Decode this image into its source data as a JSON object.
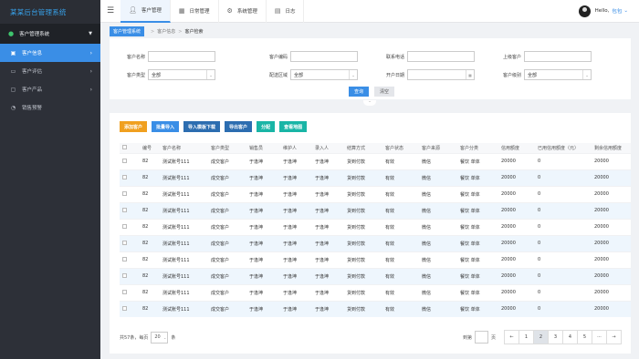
{
  "app": {
    "title": "某某后台管理系统"
  },
  "sidebar": {
    "system_label": "客户管理系统",
    "items": [
      {
        "label": "客户信息",
        "icon": "user-icon"
      },
      {
        "label": "客户评估",
        "icon": "folder-icon"
      },
      {
        "label": "客户产品",
        "icon": "box-icon"
      },
      {
        "label": "销售预警",
        "icon": "bell-icon"
      }
    ]
  },
  "topbar": {
    "tabs": [
      {
        "label": "客户管理",
        "icon": "user-icon"
      },
      {
        "label": "日常管理",
        "icon": "grid-icon"
      },
      {
        "label": "系统管理",
        "icon": "gear-icon"
      },
      {
        "label": "日志",
        "icon": "doc-icon"
      }
    ],
    "greeting": "Hello,",
    "user_name": "包包"
  },
  "breadcrumb": [
    "客户管理系统",
    "客户信息",
    "客户检索"
  ],
  "search": {
    "fields": [
      {
        "label": "客户名称",
        "value": ""
      },
      {
        "label": "客户编码",
        "value": ""
      },
      {
        "label": "联系电话",
        "value": ""
      },
      {
        "label": "上级客户",
        "value": ""
      },
      {
        "label": "客户类型",
        "value": "全部"
      },
      {
        "label": "配送区域",
        "value": "全部"
      },
      {
        "label": "开户日期",
        "value": ""
      },
      {
        "label": "客户级别",
        "value": "全部"
      }
    ],
    "query_label": "查询",
    "clear_label": "清空"
  },
  "toolbar": {
    "buttons": [
      {
        "label": "添加客户",
        "color": "#f0a020"
      },
      {
        "label": "批量导入",
        "color": "#3a8ee6"
      },
      {
        "label": "导入模板下载",
        "color": "#2c6db0"
      },
      {
        "label": "导出客户",
        "color": "#2c6db0"
      },
      {
        "label": "分配",
        "color": "#19b5a6"
      },
      {
        "label": "查看地图",
        "color": "#19b5a6"
      }
    ]
  },
  "table": {
    "columns": [
      "",
      "编号",
      "客户名称",
      "客户类型",
      "销售员",
      "维护人",
      "录入人",
      "结算方式",
      "客户状态",
      "客户来源",
      "客户分类",
      "信用额度",
      "已用信用额度（元）",
      "剩余信用额度"
    ],
    "rows": [
      [
        "82",
        "测试账号111",
        "成交客户",
        "于逢坤",
        "于逢坤",
        "于逢坤",
        "货到付款",
        "有效",
        "微信",
        "餐饮 单体",
        "20000",
        "0",
        "20000"
      ],
      [
        "82",
        "测试账号111",
        "成交客户",
        "于逢坤",
        "于逢坤",
        "于逢坤",
        "货到付款",
        "有效",
        "微信",
        "餐饮 单体",
        "20000",
        "0",
        "20000"
      ],
      [
        "82",
        "测试账号111",
        "成交客户",
        "于逢坤",
        "于逢坤",
        "于逢坤",
        "货到付款",
        "有效",
        "微信",
        "餐饮 单体",
        "20000",
        "0",
        "20000"
      ],
      [
        "82",
        "测试账号111",
        "成交客户",
        "于逢坤",
        "于逢坤",
        "于逢坤",
        "货到付款",
        "有效",
        "微信",
        "餐饮 单体",
        "20000",
        "0",
        "20000"
      ],
      [
        "82",
        "测试账号111",
        "成交客户",
        "于逢坤",
        "于逢坤",
        "于逢坤",
        "货到付款",
        "有效",
        "微信",
        "餐饮 单体",
        "20000",
        "0",
        "20000"
      ],
      [
        "82",
        "测试账号111",
        "成交客户",
        "于逢坤",
        "于逢坤",
        "于逢坤",
        "货到付款",
        "有效",
        "微信",
        "餐饮 单体",
        "20000",
        "0",
        "20000"
      ],
      [
        "82",
        "测试账号111",
        "成交客户",
        "于逢坤",
        "于逢坤",
        "于逢坤",
        "货到付款",
        "有效",
        "微信",
        "餐饮 单体",
        "20000",
        "0",
        "20000"
      ],
      [
        "82",
        "测试账号111",
        "成交客户",
        "于逢坤",
        "于逢坤",
        "于逢坤",
        "货到付款",
        "有效",
        "微信",
        "餐饮 单体",
        "20000",
        "0",
        "20000"
      ],
      [
        "82",
        "测试账号111",
        "成交客户",
        "于逢坤",
        "于逢坤",
        "于逢坤",
        "货到付款",
        "有效",
        "微信",
        "餐饮 单体",
        "20000",
        "0",
        "20000"
      ],
      [
        "82",
        "测试账号111",
        "成交客户",
        "于逢坤",
        "于逢坤",
        "于逢坤",
        "货到付款",
        "有效",
        "微信",
        "餐饮 单体",
        "20000",
        "0",
        "20000"
      ]
    ]
  },
  "footer": {
    "total_prefix": "共57条，每页",
    "page_size": "20",
    "total_suffix": "条",
    "goto_label": "到第",
    "goto_suffix": "页",
    "pages": [
      "←",
      "1",
      "2",
      "3",
      "4",
      "5",
      "···",
      "→"
    ],
    "current_page": "2"
  }
}
